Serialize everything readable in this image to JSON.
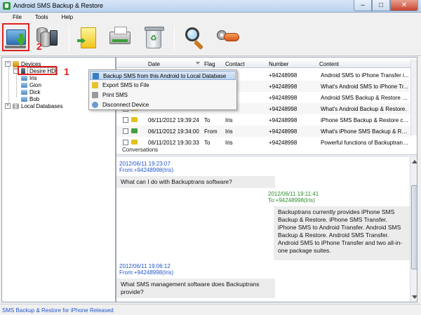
{
  "window": {
    "title": "Android SMS Backup & Restore"
  },
  "menu": [
    "File",
    "Tools",
    "Help"
  ],
  "annotations": {
    "label1": "1",
    "label2": "2"
  },
  "tree": {
    "devices_label": "Devices",
    "device_name": "Desire HD",
    "contacts": [
      "Iris",
      "Gion",
      "Dick",
      "Bob"
    ],
    "local_db_label": "Local Databases"
  },
  "list": {
    "columns": {
      "date": "Date",
      "flag": "Flag",
      "contact": "Contact",
      "number": "Number",
      "content": "Content"
    },
    "rows": [
      {
        "date": "",
        "flag": "",
        "contact": "",
        "number": "+94248998",
        "content": "Android SMS to iPhone Transfer i...",
        "dir": "in"
      },
      {
        "date": "",
        "flag": "",
        "contact": "",
        "number": "+94248998",
        "content": "What's Android SMS to iPhone Tr...",
        "dir": "in"
      },
      {
        "date": "",
        "flag": "",
        "contact": "",
        "number": "+94248998",
        "content": "Android SMS Backup & Restore c...",
        "dir": "in"
      },
      {
        "date": "",
        "flag": "",
        "contact": "",
        "number": "+94248998",
        "content": "What's Android Backup & Restore.",
        "dir": "in"
      },
      {
        "date": "06/11/2012 19:39:24",
        "flag": "To",
        "contact": "Iris",
        "number": "+94248998",
        "content": "iPhone SMS Backup & Restore ca...",
        "dir": "in"
      },
      {
        "date": "06/11/2012 19:34:00",
        "flag": "From",
        "contact": "Iris",
        "number": "+94248998",
        "content": "What's iPhone SMS Backup & Res...",
        "dir": "out"
      },
      {
        "date": "06/11/2012 19:30:33",
        "flag": "To",
        "contact": "Iris",
        "number": "+94248998",
        "content": "Powerful functions of Backuptrans...",
        "dir": "in"
      }
    ],
    "conversations_label": "Conversations"
  },
  "conversation": [
    {
      "time": "2012/06/11 19:23:07",
      "from": "From:+94248998(Iris)",
      "text": "What can I do with Backuptrans software?",
      "side": "left"
    },
    {
      "time": "2012/06/11 19:11:41",
      "from": "To:+94248998(Iris)",
      "text": "Backuptrans currently provides iPhone SMS Backup & Restore. iPhone SMS Transfer. iPhone SMS to Android Transfer. Android SMS Backup & Restore. Android SMS Transfer. Android SMS to iPhone Transfer and two all-in-one package suites.",
      "side": "right"
    },
    {
      "time": "2012/06/11 19:06:12",
      "from": "From:+94248998(Iris)",
      "text": "What SMS management software does Backuptrans provide?",
      "side": "left"
    }
  ],
  "context_menu": [
    "Backup SMS from this Android to Local Database",
    "Export SMS to File",
    "Print SMS",
    "Disconnect Device"
  ],
  "status": {
    "text": "SMS Backup & Restore for iPhone Released"
  },
  "colors": {
    "accent_red": "#e02020",
    "link_blue": "#2255cc",
    "sent_green": "#2e8b2e"
  }
}
